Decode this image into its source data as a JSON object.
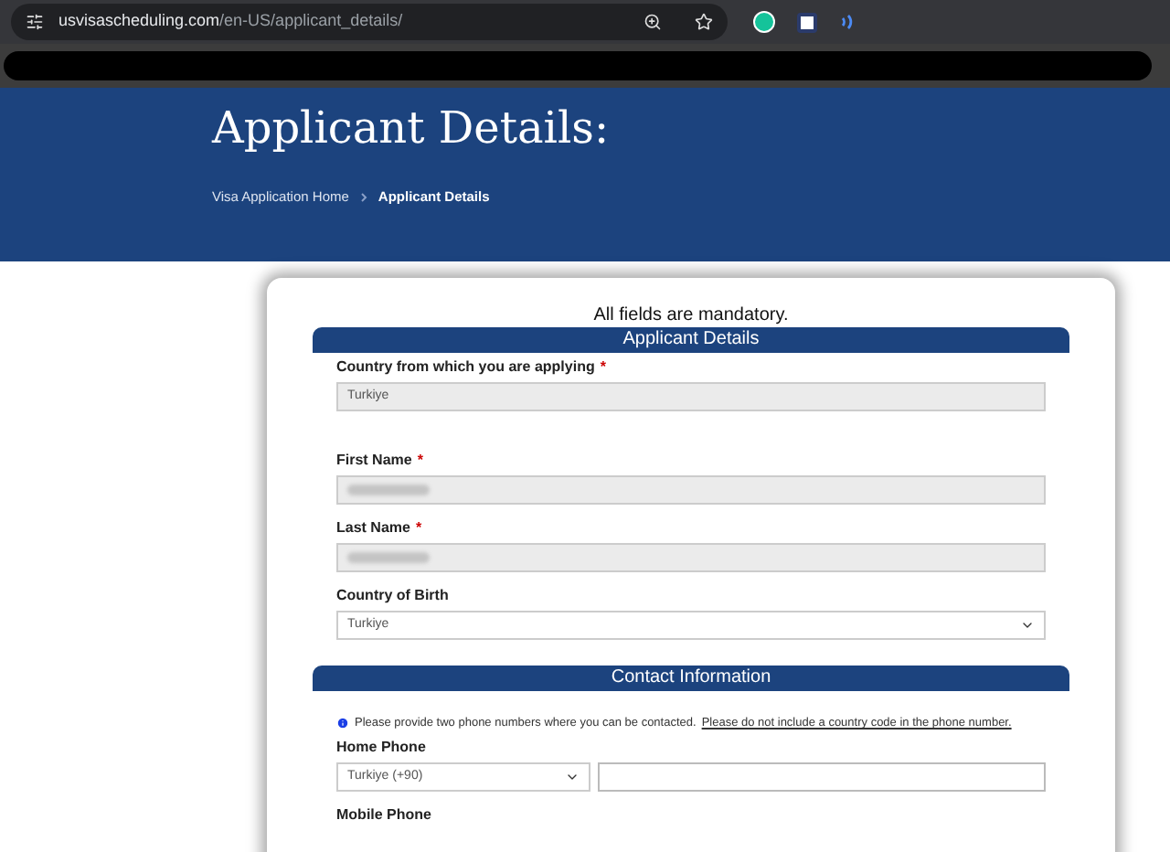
{
  "browser": {
    "url_host": "usvisascheduling.com",
    "url_path": "/en-US/applicant_details/"
  },
  "header": {
    "title": "Applicant Details:",
    "breadcrumbs": [
      {
        "label": "Visa Application Home",
        "current": false
      },
      {
        "label": "Applicant Details",
        "current": true
      }
    ]
  },
  "form": {
    "note": "All fields are mandatory.",
    "sections": [
      {
        "title": "Applicant Details",
        "fields": [
          {
            "kind": "readonly",
            "label": "Country from which you are applying",
            "required_mark": "*",
            "value": "Turkiye"
          },
          {
            "kind": "redacted",
            "label": "First Name",
            "required_mark": "*"
          },
          {
            "kind": "redacted",
            "label": "Last Name",
            "required_mark": "*"
          },
          {
            "kind": "select",
            "label": "Country of Birth",
            "value": "Turkiye"
          }
        ]
      },
      {
        "title": "Contact Information",
        "info": {
          "text": "Please provide two phone numbers where you can be contacted.",
          "link": "Please do not include a country code in the phone number."
        },
        "fields": [
          {
            "kind": "phone",
            "label": "Home Phone",
            "value": "Turkiye (+90)"
          },
          {
            "kind": "label_only",
            "label": "Mobile Phone"
          }
        ]
      }
    ]
  }
}
